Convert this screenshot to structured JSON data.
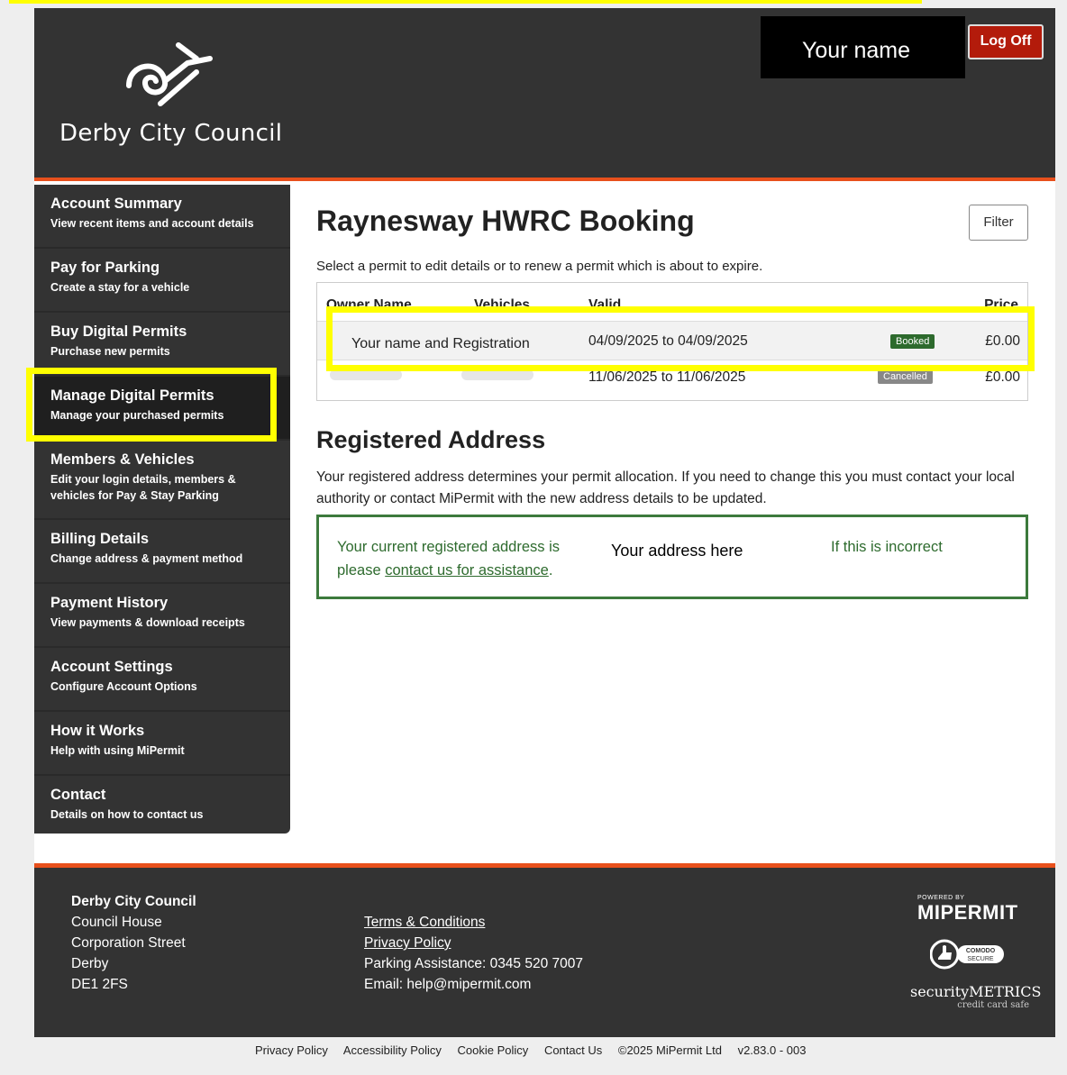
{
  "header": {
    "council_name": "Derby City Council",
    "user_name": "Your name",
    "logoff_label": "Log Off"
  },
  "sidebar": {
    "items": [
      {
        "title": "Account Summary",
        "subtitle": "View recent items and account details"
      },
      {
        "title": "Pay for Parking",
        "subtitle": "Create a stay for a vehicle"
      },
      {
        "title": "Buy Digital Permits",
        "subtitle": "Purchase new permits"
      },
      {
        "title": "Manage Digital Permits",
        "subtitle": "Manage your purchased permits"
      },
      {
        "title": "Members & Vehicles",
        "subtitle": "Edit your login details, members & vehicles for Pay & Stay Parking"
      },
      {
        "title": "Billing Details",
        "subtitle": "Change address & payment method"
      },
      {
        "title": "Payment History",
        "subtitle": "View payments & download receipts"
      },
      {
        "title": "Account Settings",
        "subtitle": "Configure Account Options"
      },
      {
        "title": "How it Works",
        "subtitle": "Help with using MiPermit"
      },
      {
        "title": "Contact",
        "subtitle": "Details on how to contact us"
      }
    ]
  },
  "main": {
    "title": "Raynesway HWRC Booking",
    "filter_label": "Filter",
    "subtitle": "Select a permit to edit details or to renew a permit which is about to expire.",
    "table": {
      "headers": [
        "Owner Name",
        "Vehicles",
        "Valid",
        "Price"
      ],
      "rows": [
        {
          "owner": "Your name and Registration",
          "valid": "04/09/2025 to 04/09/2025",
          "status": "Booked",
          "price": "£0.00"
        },
        {
          "owner": "",
          "valid": "11/06/2025 to 11/06/2025",
          "status": "Cancelled",
          "price": "£0.00"
        }
      ]
    },
    "address": {
      "title": "Registered Address",
      "text": "Your registered address determines your permit allocation. If you need to change this you must contact your local authority or contact MiPermit with the new address details to be updated.",
      "box_lead": "Your current registered address is",
      "address_value": "Your address here",
      "incorrect": "If this is incorrect",
      "please": "please",
      "contact_link": "contact us for assistance",
      "period": "."
    }
  },
  "footer": {
    "council_name": "Derby City Council",
    "address_lines": [
      "Council House",
      "Corporation Street",
      "Derby",
      "DE1 2FS"
    ],
    "terms": "Terms & Conditions",
    "privacy": "Privacy Policy",
    "phone": "Parking Assistance: 0345 520 7007",
    "email": "Email: help@mipermit.com",
    "powered_by": "POWERED BY",
    "mipermit": "MIPERMIT",
    "comodo_top": "COMODO",
    "comodo_bottom": "SECURE",
    "security": "securityMETRICS",
    "security_sub": "credit card safe"
  },
  "bottom_links": [
    "Privacy Policy",
    "Accessibility Policy",
    "Cookie Policy",
    "Contact Us",
    "©2025 MiPermit Ltd",
    "v2.83.0 - 003"
  ],
  "colors": {
    "accent": "#e8501c",
    "header_bg": "#333333",
    "highlight": "#ffff00",
    "booked": "#2d6a2d",
    "address_green": "#3c7a3c"
  }
}
